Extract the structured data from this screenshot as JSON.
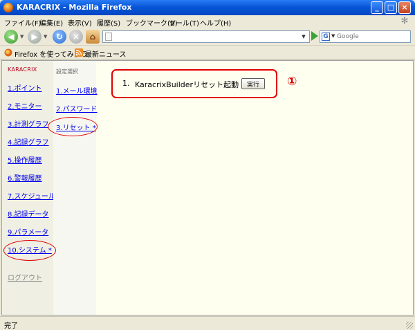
{
  "window": {
    "title": "KARACRIX - Mozilla Firefox",
    "controls": {
      "minimize": "_",
      "maximize": "□",
      "close": "×"
    }
  },
  "menu": [
    "ファイル(F)",
    "編集(E)",
    "表示(V)",
    "履歴(S)",
    "ブックマーク(B)",
    "ツール(T)",
    "ヘルプ(H)"
  ],
  "toolbar": {
    "url_value": "",
    "search_placeholder": "Google"
  },
  "bookmarks": [
    "Firefox を使ってみよう",
    "最新ニュース"
  ],
  "app": {
    "brand": "KARACRIX",
    "nav": [
      "1.ポイント",
      "2.モニター",
      "3.計測グラフ",
      "4.記録グラフ",
      "5.操作履歴",
      "6.警報履歴",
      "7.スケジュール",
      "8.記録データ",
      "9.パラメータ",
      "10.システム *"
    ],
    "logout": "ログアウト",
    "subnav_heading": "設定選択",
    "subnav": [
      "1.メール環境",
      "2.パスワード",
      "3.リセット *"
    ],
    "panel": {
      "number": "1.",
      "text": "KaracrixBuilderリセット起動",
      "button": "実行"
    },
    "annotation": "①"
  },
  "status": "完了",
  "colors": {
    "accent_red": "#e00000",
    "link": "#0000ee",
    "brand_red": "#b8001c",
    "content_bg": "#fffff0"
  }
}
